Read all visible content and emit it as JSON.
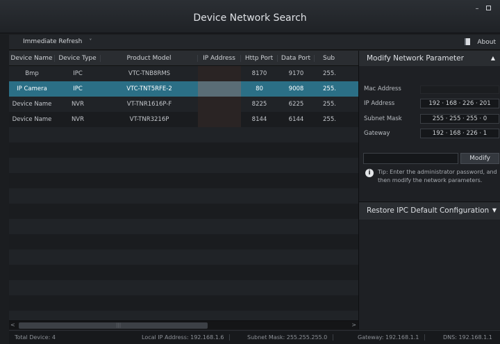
{
  "window": {
    "title": "Device Network Search",
    "min_glyph": "–",
    "max_glyph": ""
  },
  "toolbar": {
    "refresh_label": "Immediate Refresh",
    "refresh_chevron": "˅",
    "about_label": "About"
  },
  "table": {
    "columns": [
      "Device Name",
      "Device Type",
      "Product Model",
      "IP Address",
      "Http Port",
      "Data Port",
      "Sub"
    ],
    "rows": [
      {
        "name": "Bmp",
        "type": "IPC",
        "model": "VTC-TNB8RMS",
        "ip": "",
        "http": "8170",
        "data": "9170",
        "sub": "255."
      },
      {
        "name": "IP Camera",
        "type": "IPC",
        "model": "VTC-TNT5RFE-2",
        "ip": "",
        "http": "80",
        "data": "9008",
        "sub": "255."
      },
      {
        "name": "Device Name",
        "type": "NVR",
        "model": "VT-TNR1616P-F",
        "ip": "",
        "http": "8225",
        "data": "6225",
        "sub": "255."
      },
      {
        "name": "Device Name",
        "type": "NVR",
        "model": "VT-TNR3216P",
        "ip": "",
        "http": "8144",
        "data": "6144",
        "sub": "255."
      }
    ],
    "selected_row": 1
  },
  "scrollbar": {
    "left_arrow": "<",
    "right_arrow": ">",
    "grip": "|||"
  },
  "panel": {
    "title": "Modify Network Parameter",
    "collapse_glyph": "▲",
    "mac_label": "Mac Address",
    "ip_label": "IP Address",
    "ip_value": "192 · 168 · 226 · 201",
    "mask_label": "Subnet Mask",
    "mask_value": "255 · 255 · 255 · 0",
    "gateway_label": "Gateway",
    "gateway_value": "192 · 168 · 226 · 1",
    "modify_label": "Modify",
    "tip_icon": "i",
    "tip_line1": "Tip: Enter the administrator password, and",
    "tip_line2": "then modify the network parameters.",
    "restore_title": "Restore IPC Default Configuration",
    "restore_glyph": "▼"
  },
  "status": {
    "total": "Total Device: 4",
    "local_ip": "Local IP Address: 192.168.1.6",
    "mask": "Subnet Mask: 255.255.255.0",
    "gateway": "Gateway: 192.168.1.1",
    "dns": "DNS: 192.168.1.1"
  }
}
